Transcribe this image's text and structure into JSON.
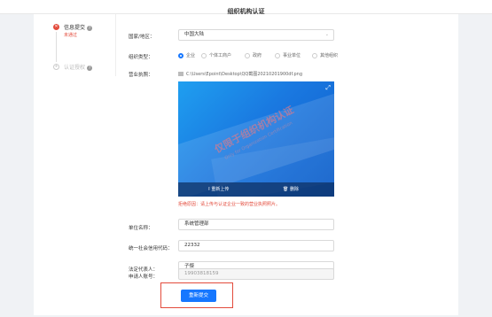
{
  "header": {
    "title": "组织机构认证"
  },
  "steps": [
    {
      "label": "信息提交",
      "status": "未通过",
      "icon": "x-mark-icon"
    },
    {
      "label": "认证授权",
      "icon": "plus-icon"
    }
  ],
  "help_icon": "?",
  "form": {
    "region": {
      "label": "国家/地区：",
      "value": "中国大陆"
    },
    "org_type": {
      "label": "组织类型：",
      "options": [
        "企业",
        "个体工商户",
        "政府",
        "事业单位",
        "其他组织"
      ],
      "selected": "企业"
    },
    "license": {
      "label": "营业执照：",
      "file_path": "C:\\Users\\Epoint\\Desktop\\QQ截图20210201900df.png",
      "watermark": "仅限于组织机构认证",
      "watermark_sub": "Only for Organization Certification",
      "reupload_label": "重新上传",
      "delete_label": "删除",
      "reject_reason": "拒绝原因：请上传与认证企业一致的营业执照照片。"
    },
    "company_name": {
      "label": "单位名称：",
      "value": "系统管理部"
    },
    "credit_code": {
      "label": "统一社会信用代码：",
      "value": "22332"
    },
    "legal_rep": {
      "label": "法定代表人：",
      "value": "子傑"
    },
    "applicant": {
      "label": "申请人账号：",
      "value": "19903818159"
    },
    "resubmit_label": "重新提交"
  },
  "colors": {
    "primary": "#1677ff",
    "danger": "#e34b3c"
  }
}
